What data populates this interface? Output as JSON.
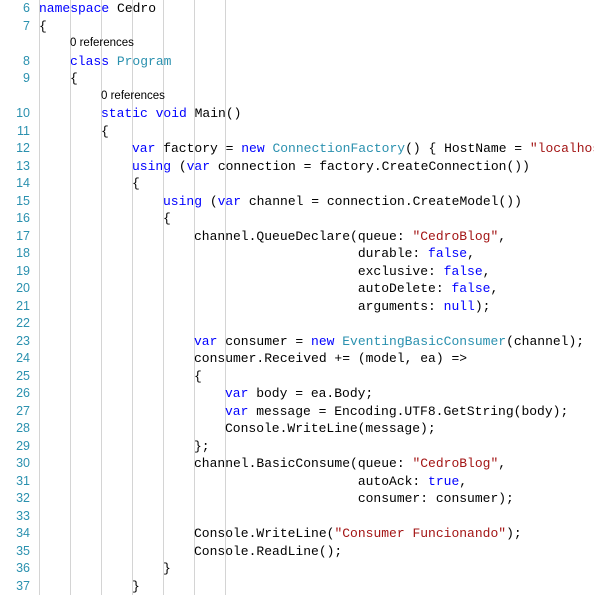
{
  "editor": {
    "language": "csharp",
    "first_line_number": 6,
    "last_line_number": 37,
    "colors": {
      "background": "#FFFFFF",
      "line_number": "#2B91AF",
      "keyword": "#0000FF",
      "type": "#2B91AF",
      "string": "#A31515",
      "plain": "#000000",
      "codelens": "#808080",
      "indent_guide": "#D4D4D4"
    },
    "codelens_label": "0 references",
    "lines": [
      {
        "n": 6,
        "indent": 0,
        "tokens": [
          {
            "t": "kw",
            "v": "namespace"
          },
          {
            "t": "pln",
            "v": " Cedro"
          }
        ]
      },
      {
        "n": 7,
        "indent": 0,
        "tokens": [
          {
            "t": "pln",
            "v": "{"
          }
        ]
      },
      {
        "n": null,
        "indent": 1,
        "lens": true,
        "tokens": [
          {
            "t": "pln",
            "v": "0 references"
          }
        ]
      },
      {
        "n": 8,
        "indent": 1,
        "tokens": [
          {
            "t": "kw",
            "v": "class"
          },
          {
            "t": "pln",
            "v": " "
          },
          {
            "t": "typ",
            "v": "Program"
          }
        ]
      },
      {
        "n": 9,
        "indent": 1,
        "tokens": [
          {
            "t": "pln",
            "v": "{"
          }
        ]
      },
      {
        "n": null,
        "indent": 2,
        "lens": true,
        "tokens": [
          {
            "t": "pln",
            "v": "0 references"
          }
        ]
      },
      {
        "n": 10,
        "indent": 2,
        "tokens": [
          {
            "t": "kw",
            "v": "static void"
          },
          {
            "t": "pln",
            "v": " Main()"
          }
        ]
      },
      {
        "n": 11,
        "indent": 2,
        "tokens": [
          {
            "t": "pln",
            "v": "{"
          }
        ]
      },
      {
        "n": 12,
        "indent": 3,
        "tokens": [
          {
            "t": "kw",
            "v": "var"
          },
          {
            "t": "pln",
            "v": " factory = "
          },
          {
            "t": "kw",
            "v": "new"
          },
          {
            "t": "pln",
            "v": " "
          },
          {
            "t": "typ",
            "v": "ConnectionFactory"
          },
          {
            "t": "pln",
            "v": "() { HostName = "
          },
          {
            "t": "str",
            "v": "\"localhost\""
          },
          {
            "t": "pln",
            "v": " };"
          }
        ]
      },
      {
        "n": 13,
        "indent": 3,
        "tokens": [
          {
            "t": "kw",
            "v": "using"
          },
          {
            "t": "pln",
            "v": " ("
          },
          {
            "t": "kw",
            "v": "var"
          },
          {
            "t": "pln",
            "v": " connection = factory.CreateConnection())"
          }
        ]
      },
      {
        "n": 14,
        "indent": 3,
        "tokens": [
          {
            "t": "pln",
            "v": "{"
          }
        ]
      },
      {
        "n": 15,
        "indent": 4,
        "tokens": [
          {
            "t": "kw",
            "v": "using"
          },
          {
            "t": "pln",
            "v": " ("
          },
          {
            "t": "kw",
            "v": "var"
          },
          {
            "t": "pln",
            "v": " channel = connection.CreateModel())"
          }
        ]
      },
      {
        "n": 16,
        "indent": 4,
        "tokens": [
          {
            "t": "pln",
            "v": "{"
          }
        ]
      },
      {
        "n": 17,
        "indent": 5,
        "tokens": [
          {
            "t": "pln",
            "v": "channel.QueueDeclare(queue: "
          },
          {
            "t": "str",
            "v": "\"CedroBlog\""
          },
          {
            "t": "pln",
            "v": ","
          }
        ]
      },
      {
        "n": 18,
        "indent": 5,
        "tokens": [
          {
            "t": "pln",
            "v": "                     durable: "
          },
          {
            "t": "kw",
            "v": "false"
          },
          {
            "t": "pln",
            "v": ","
          }
        ]
      },
      {
        "n": 19,
        "indent": 5,
        "tokens": [
          {
            "t": "pln",
            "v": "                     exclusive: "
          },
          {
            "t": "kw",
            "v": "false"
          },
          {
            "t": "pln",
            "v": ","
          }
        ]
      },
      {
        "n": 20,
        "indent": 5,
        "tokens": [
          {
            "t": "pln",
            "v": "                     autoDelete: "
          },
          {
            "t": "kw",
            "v": "false"
          },
          {
            "t": "pln",
            "v": ","
          }
        ]
      },
      {
        "n": 21,
        "indent": 5,
        "tokens": [
          {
            "t": "pln",
            "v": "                     arguments: "
          },
          {
            "t": "kw",
            "v": "null"
          },
          {
            "t": "pln",
            "v": ");"
          }
        ]
      },
      {
        "n": 22,
        "indent": 5,
        "tokens": []
      },
      {
        "n": 23,
        "indent": 5,
        "tokens": [
          {
            "t": "kw",
            "v": "var"
          },
          {
            "t": "pln",
            "v": " consumer = "
          },
          {
            "t": "kw",
            "v": "new"
          },
          {
            "t": "pln",
            "v": " "
          },
          {
            "t": "typ",
            "v": "EventingBasicConsumer"
          },
          {
            "t": "pln",
            "v": "(channel);"
          }
        ]
      },
      {
        "n": 24,
        "indent": 5,
        "tokens": [
          {
            "t": "pln",
            "v": "consumer.Received += (model, ea) =>"
          }
        ]
      },
      {
        "n": 25,
        "indent": 5,
        "tokens": [
          {
            "t": "pln",
            "v": "{"
          }
        ]
      },
      {
        "n": 26,
        "indent": 6,
        "tokens": [
          {
            "t": "kw",
            "v": "var"
          },
          {
            "t": "pln",
            "v": " body = ea.Body;"
          }
        ]
      },
      {
        "n": 27,
        "indent": 6,
        "tokens": [
          {
            "t": "kw",
            "v": "var"
          },
          {
            "t": "pln",
            "v": " message = Encoding.UTF8.GetString(body);"
          }
        ]
      },
      {
        "n": 28,
        "indent": 6,
        "tokens": [
          {
            "t": "pln",
            "v": "Console.WriteLine(message);"
          }
        ]
      },
      {
        "n": 29,
        "indent": 5,
        "tokens": [
          {
            "t": "pln",
            "v": "};"
          }
        ]
      },
      {
        "n": 30,
        "indent": 5,
        "tokens": [
          {
            "t": "pln",
            "v": "channel.BasicConsume(queue: "
          },
          {
            "t": "str",
            "v": "\"CedroBlog\""
          },
          {
            "t": "pln",
            "v": ","
          }
        ]
      },
      {
        "n": 31,
        "indent": 5,
        "tokens": [
          {
            "t": "pln",
            "v": "                     autoAck: "
          },
          {
            "t": "kw",
            "v": "true"
          },
          {
            "t": "pln",
            "v": ","
          }
        ]
      },
      {
        "n": 32,
        "indent": 5,
        "tokens": [
          {
            "t": "pln",
            "v": "                     consumer: consumer);"
          }
        ]
      },
      {
        "n": 33,
        "indent": 5,
        "tokens": []
      },
      {
        "n": 34,
        "indent": 5,
        "tokens": [
          {
            "t": "pln",
            "v": "Console.WriteLine("
          },
          {
            "t": "str",
            "v": "\"Consumer Funcionando\""
          },
          {
            "t": "pln",
            "v": ");"
          }
        ]
      },
      {
        "n": 35,
        "indent": 5,
        "tokens": [
          {
            "t": "pln",
            "v": "Console.ReadLine();"
          }
        ]
      },
      {
        "n": 36,
        "indent": 4,
        "tokens": [
          {
            "t": "pln",
            "v": "}"
          }
        ]
      },
      {
        "n": 37,
        "indent": 3,
        "tokens": [
          {
            "t": "pln",
            "v": "}"
          }
        ]
      }
    ],
    "indent_guides_x": [
      39,
      70,
      101,
      132,
      163,
      194,
      225
    ]
  }
}
